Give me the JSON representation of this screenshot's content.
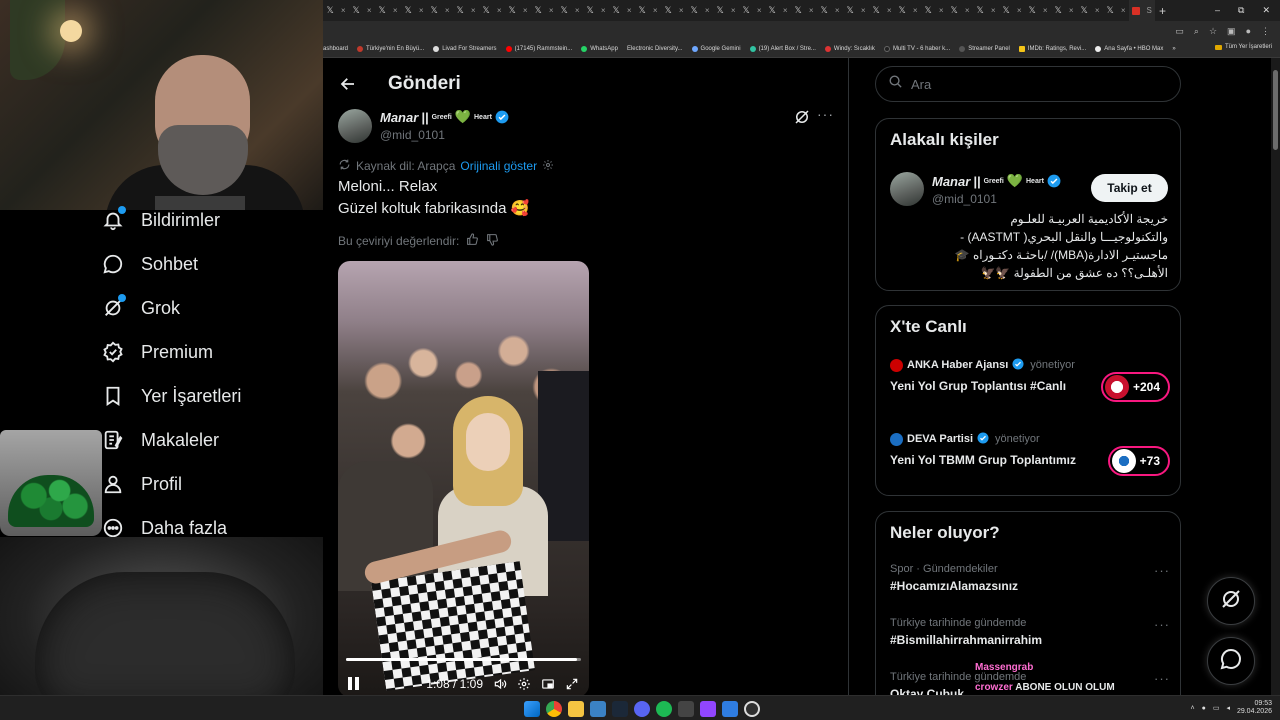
{
  "browser": {
    "tab_glyph": "𝕏",
    "tab_close": "×",
    "new_tab": "+",
    "window_controls": [
      "–",
      "⧉",
      "✕"
    ],
    "active_tab_label": "S",
    "bookmarks": [
      "ashboard",
      "Türkiye'nin En Büyü...",
      "Livad For Streamers",
      "(17145) Rammstein...",
      "WhatsApp",
      "Electronic Diversity...",
      "Google Gemini",
      "(19) Alert Box / Stre...",
      "Windy: Sıcaklık",
      "Multi TV - 6 haber k...",
      "Streamer Panel",
      "IMDb: Ratings, Revi...",
      "Ana Sayfa • HBO Max"
    ],
    "bookmarks_overflow": "»",
    "all_bookmarks": "Tüm Yer İşaretleri"
  },
  "sidebar": {
    "items": [
      {
        "label": "Bildirimler",
        "icon": "bell-icon"
      },
      {
        "label": "Sohbet",
        "icon": "chat-icon"
      },
      {
        "label": "Grok",
        "icon": "grok-icon"
      },
      {
        "label": "Premium",
        "icon": "premium-icon"
      },
      {
        "label": "Yer İşaretleri",
        "icon": "bookmark-icon"
      },
      {
        "label": "Makaleler",
        "icon": "article-icon"
      },
      {
        "label": "Profil",
        "icon": "profile-icon"
      },
      {
        "label": "Daha fazla",
        "icon": "more-circle-icon"
      }
    ]
  },
  "post": {
    "header_title": "Gönderi",
    "author": {
      "name": "Manar",
      "name_sep": "||",
      "sup1": "Greefi",
      "heart": "💚",
      "sup2": "Heart",
      "handle": "@mid_0101"
    },
    "more": "···",
    "source_lang": "Kaynak dil: Arapça",
    "show_original": "Orijinali göster",
    "text_line1": "Meloni... Relax",
    "text_line2": "Güzel koltuk fabrikasında 🥰",
    "rate_translation": "Bu çeviriyi değerlendir:",
    "video": {
      "time": "1:08 / 1:09",
      "progress": 0.985
    }
  },
  "right": {
    "search_placeholder": "Ara",
    "related": {
      "title": "Alakalı kişiler",
      "follow_label": "Takip et",
      "bio_lines": [
        "خريجة الأكاديمية العربيـة للعلـوم",
        "والتكنولوجيـــا والنقل البحري( AASTMT) -",
        "ماجستيـر الادارة(MBA)/ /باحثـة دكتـوراه 🎓",
        "الأهلـى؟؟ ده عشق من الطفولة 🦅🦅"
      ]
    },
    "live": {
      "title": "X'te Canlı",
      "items": [
        {
          "host": "ANKA Haber Ajansı",
          "role": "yönetiyor",
          "title": "Yeni Yol Grup Toplantısı #Canlı",
          "count": "+204"
        },
        {
          "host": "DEVA Partisi",
          "role": "yönetiyor",
          "title": "Yeni Yol TBMM Grup Toplantımız",
          "count": "+73"
        }
      ]
    },
    "trends": {
      "title": "Neler oluyor?",
      "items": [
        {
          "meta": "Spor · Gündemdekiler",
          "name": "#HocamızıAlamazsınız"
        },
        {
          "meta": "Türkiye tarihinde gündemde",
          "name": "#Bismillahirrahmanirrahim"
        },
        {
          "meta": "Türkiye tarihinde gündemde",
          "name": "Oktay Çubuk"
        }
      ]
    }
  },
  "stream_chat": [
    {
      "user": "Massengrab",
      "message": ""
    },
    {
      "user": "crowzer",
      "message": "ABONE OLUN OLUM"
    },
    {
      "user": "crowzer",
      "message": ""
    }
  ],
  "taskbar": {
    "time": "09:53",
    "date": "29.04.2026"
  },
  "colors": {
    "accent": "#1d9bf0",
    "live_ring": "#f91880",
    "background": "#000000",
    "text": "#e7e9ea",
    "muted": "#71767b"
  }
}
